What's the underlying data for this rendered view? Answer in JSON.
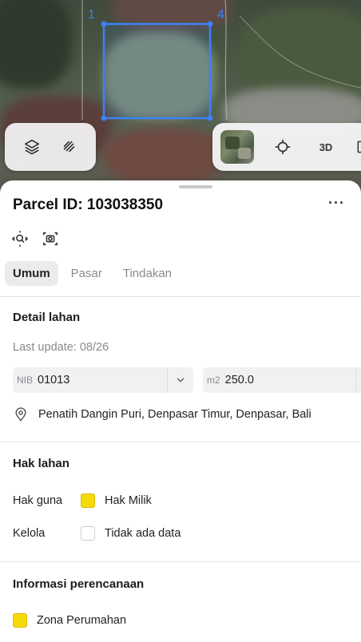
{
  "map": {
    "vertex_labels": [
      "1",
      "4"
    ]
  },
  "map_controls": {
    "layers_icon": "layers-icon",
    "draw_icon": "draw-path-icon",
    "satellite_icon": "satellite-thumbnail-icon",
    "locate_icon": "crosshair-icon",
    "three_d_label": "3D",
    "fullscreen_icon": "expand-icon"
  },
  "parcel": {
    "title": "Parcel ID: 103038350",
    "more_label": "···"
  },
  "tabs": [
    {
      "label": "Umum",
      "active": true
    },
    {
      "label": "Pasar",
      "active": false
    },
    {
      "label": "Tindakan",
      "active": false
    }
  ],
  "detail": {
    "heading": "Detail lahan",
    "last_update": "Last update: 08/26",
    "nib_prefix": "NIB",
    "nib_value": "01013",
    "area_prefix": "m2",
    "area_value": "250.0",
    "address": "Penatih Dangin Puri, Denpasar Timur, Denpasar, Bali"
  },
  "rights": {
    "heading": "Hak lahan",
    "rows": [
      {
        "label": "Hak guna",
        "value": "Hak Milik",
        "color": "#f5d90a"
      },
      {
        "label": "Kelola",
        "value": "Tidak ada data",
        "color": "#ffffff"
      }
    ]
  },
  "planning": {
    "heading": "Informasi perencanaan",
    "zone_label": "Zona Perumahan",
    "zone_color": "#f5d90a"
  },
  "colors": {
    "accent_blue": "#3b82f6",
    "zone_yellow": "#f5d90a"
  }
}
